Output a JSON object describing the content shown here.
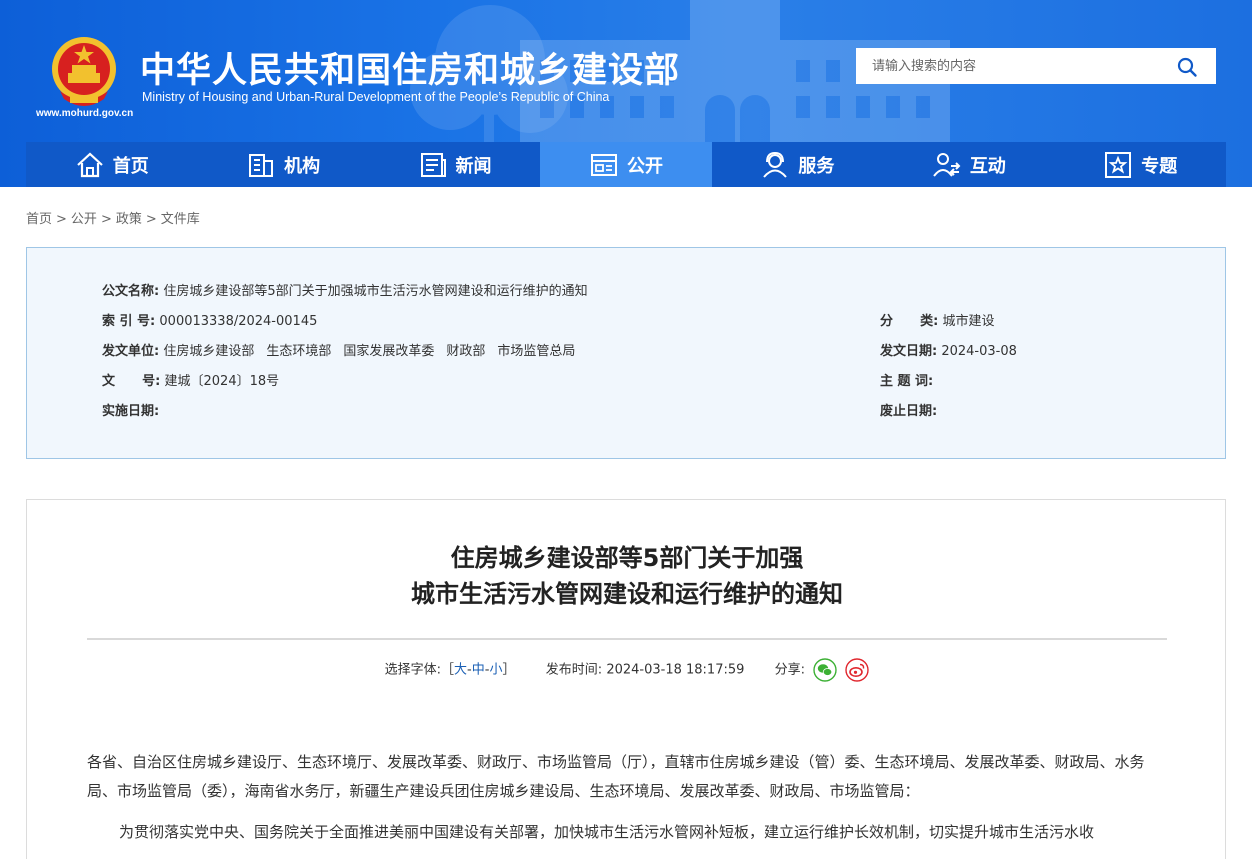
{
  "header": {
    "title": "中华人民共和国住房和城乡建设部",
    "subtitle": "Ministry of Housing and Urban-Rural Development of the People’s Republic of China",
    "url": "www.mohurd.gov.cn",
    "search_placeholder": "请输入搜索的内容"
  },
  "nav": [
    {
      "label": "首页",
      "icon": "home-icon"
    },
    {
      "label": "机构",
      "icon": "building-icon"
    },
    {
      "label": "新闻",
      "icon": "news-icon"
    },
    {
      "label": "公开",
      "icon": "open-info-icon",
      "active": true
    },
    {
      "label": "服务",
      "icon": "service-icon"
    },
    {
      "label": "互动",
      "icon": "interaction-icon"
    },
    {
      "label": "专题",
      "icon": "topic-star-icon"
    }
  ],
  "breadcrumb": [
    "首页",
    "公开",
    "政策",
    "文件库"
  ],
  "breadcrumb_sep": ">",
  "info": {
    "name_label": "公文名称:",
    "name_value": "住房城乡建设部等5部门关于加强城市生活污水管网建设和运行维护的通知",
    "index_label": "索 引 号:",
    "index_value": "000013338/2024-00145",
    "category_label": "分      类:",
    "category_value": "城市建设",
    "issuer_label": "发文单位:",
    "issuers": [
      "住房城乡建设部",
      "生态环境部",
      "国家发展改革委",
      "财政部",
      "市场监管总局"
    ],
    "date_label": "发文日期:",
    "date_value": "2024-03-08",
    "docno_label": "文      号:",
    "docno_value": "建城〔2024〕18号",
    "keywords_label": "主 题 词:",
    "keywords_value": "",
    "effective_label": "实施日期:",
    "effective_value": "",
    "expiry_label": "废止日期:",
    "expiry_value": ""
  },
  "article": {
    "title_line1": "住房城乡建设部等5部门关于加强",
    "title_line2": "城市生活污水管网建设和运行维护的通知",
    "fontsize_label": "选择字体:［",
    "fontsize_large": "大",
    "fontsize_medium": "中",
    "fontsize_small": "小",
    "fontsize_close": "］",
    "fontsize_dash": "-",
    "publish_label": "发布时间:",
    "publish_time": "2024-03-18 18:17:59",
    "share_label": "分享:",
    "para1": "各省、自治区住房城乡建设厅、生态环境厅、发展改革委、财政厅、市场监管局（厅），直辖市住房城乡建设（管）委、生态环境局、发展改革委、财政局、水务局、市场监管局（委），海南省水务厅，新疆生产建设兵团住房城乡建设局、生态环境局、发展改革委、财政局、市场监管局：",
    "para2": "为贯彻落实党中央、国务院关于全面推进美丽中国建设有关部署，加快城市生活污水管网补短板，建立运行维护长效机制，切实提升城市生活污水收"
  },
  "colors": {
    "header_blue": "#1a73e6",
    "nav_blue": "#1059c8",
    "nav_active": "#3d8ef0",
    "info_bg": "#f1f7fd",
    "wechat_green": "#3cb034",
    "weibo_red": "#e0262d"
  }
}
